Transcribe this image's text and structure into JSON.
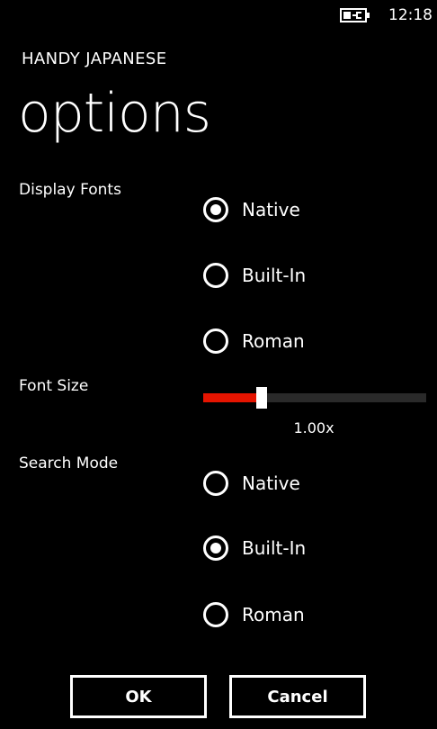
{
  "status_bar": {
    "time": "12:18",
    "battery_icon": "battery-charging-icon"
  },
  "app_title": "HANDY JAPANESE",
  "page_title": "options",
  "display_fonts": {
    "label": "Display Fonts",
    "options": [
      "Native",
      "Built-In",
      "Roman"
    ],
    "selected": "Native"
  },
  "font_size": {
    "label": "Font Size",
    "value_text": "1.00x",
    "level": 0.25,
    "accent_color": "#e51400"
  },
  "search_mode": {
    "label": "Search Mode",
    "options": [
      "Native",
      "Built-In",
      "Roman"
    ],
    "selected": "Built-In"
  },
  "buttons": {
    "ok": "OK",
    "cancel": "Cancel"
  }
}
